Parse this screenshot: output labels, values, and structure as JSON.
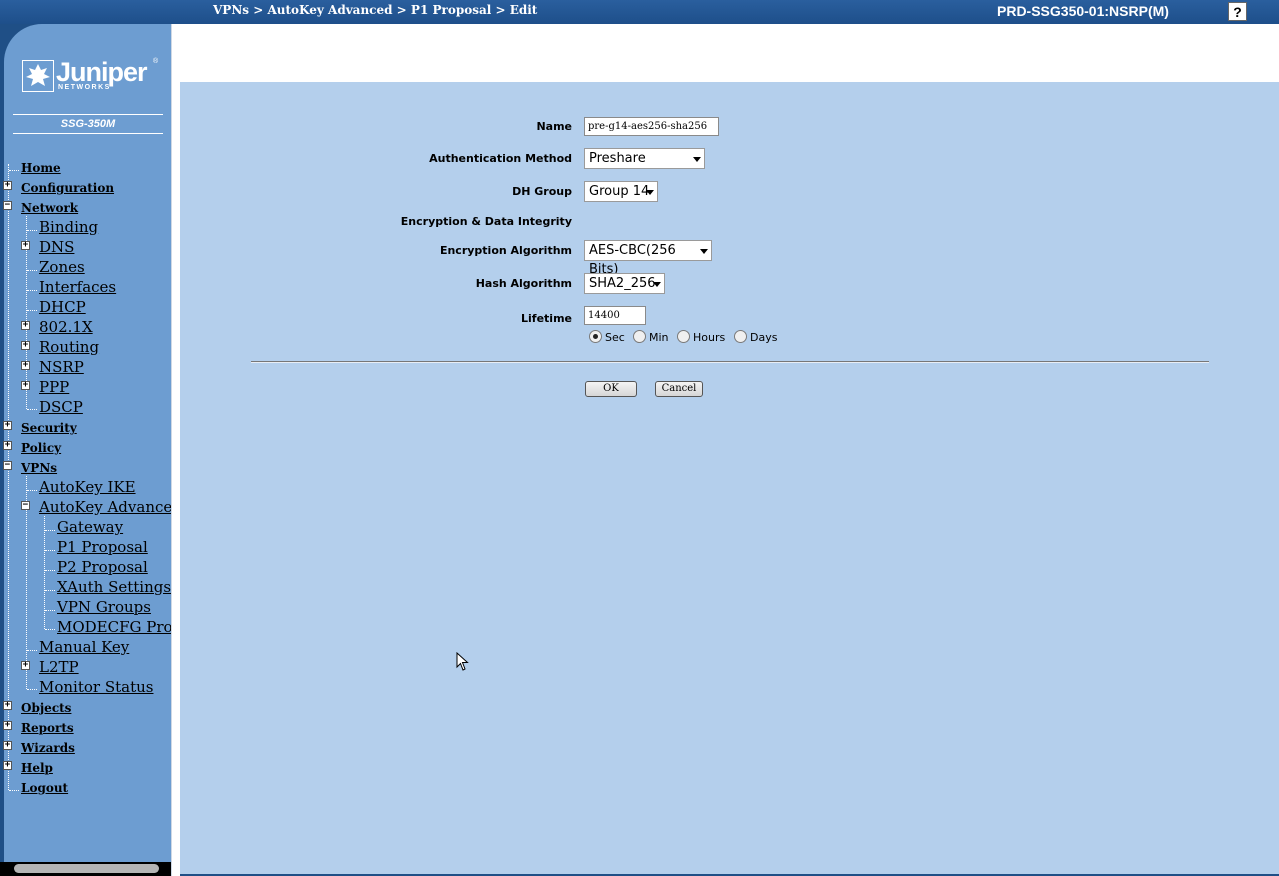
{
  "header": {
    "breadcrumb": "VPNs > AutoKey Advanced > P1 Proposal > Edit",
    "device_title": "PRD-SSG350-01:NSRP(M)",
    "help_label": "?"
  },
  "brand": {
    "logo_word": "Juniper",
    "logo_sub": "NETWORKS",
    "logo_reg": "®",
    "model": "SSG-350M"
  },
  "nav": {
    "home": "Home",
    "configuration": "Configuration",
    "network": "Network",
    "binding": "Binding",
    "dns": "DNS",
    "zones": "Zones",
    "interfaces": "Interfaces",
    "dhcp": "DHCP",
    "dot1x": "802.1X",
    "routing": "Routing",
    "nsrp": "NSRP",
    "ppp": "PPP",
    "dscp": "DSCP",
    "security": "Security",
    "policy": "Policy",
    "vpns": "VPNs",
    "autokey_ike": "AutoKey IKE",
    "autokey_advanced": "AutoKey Advanced",
    "gateway": "Gateway",
    "p1_proposal": "P1 Proposal",
    "p2_proposal": "P2 Proposal",
    "xauth_settings": "XAuth Settings",
    "vpn_groups": "VPN Groups",
    "modecfg_profile": "MODECFG Profile",
    "manual_key": "Manual Key",
    "l2tp": "L2TP",
    "monitor_status": "Monitor Status",
    "objects": "Objects",
    "reports": "Reports",
    "wizards": "Wizards",
    "help": "Help",
    "logout": "Logout"
  },
  "form": {
    "name_label": "Name",
    "name_value": "pre-g14-aes256-sha256",
    "auth_label": "Authentication Method",
    "auth_value": "Preshare",
    "dh_label": "DH Group",
    "dh_value": "Group 14",
    "enc_section_label": "Encryption & Data Integrity",
    "enc_label": "Encryption Algorithm",
    "enc_value": "AES-CBC(256 Bits)",
    "hash_label": "Hash Algorithm",
    "hash_value": "SHA2_256",
    "lifetime_label": "Lifetime",
    "lifetime_value": "14400",
    "unit_sec": "Sec",
    "unit_min": "Min",
    "unit_hours": "Hours",
    "unit_days": "Days",
    "unit_selected": "Sec",
    "ok_label": "OK",
    "cancel_label": "Cancel"
  }
}
